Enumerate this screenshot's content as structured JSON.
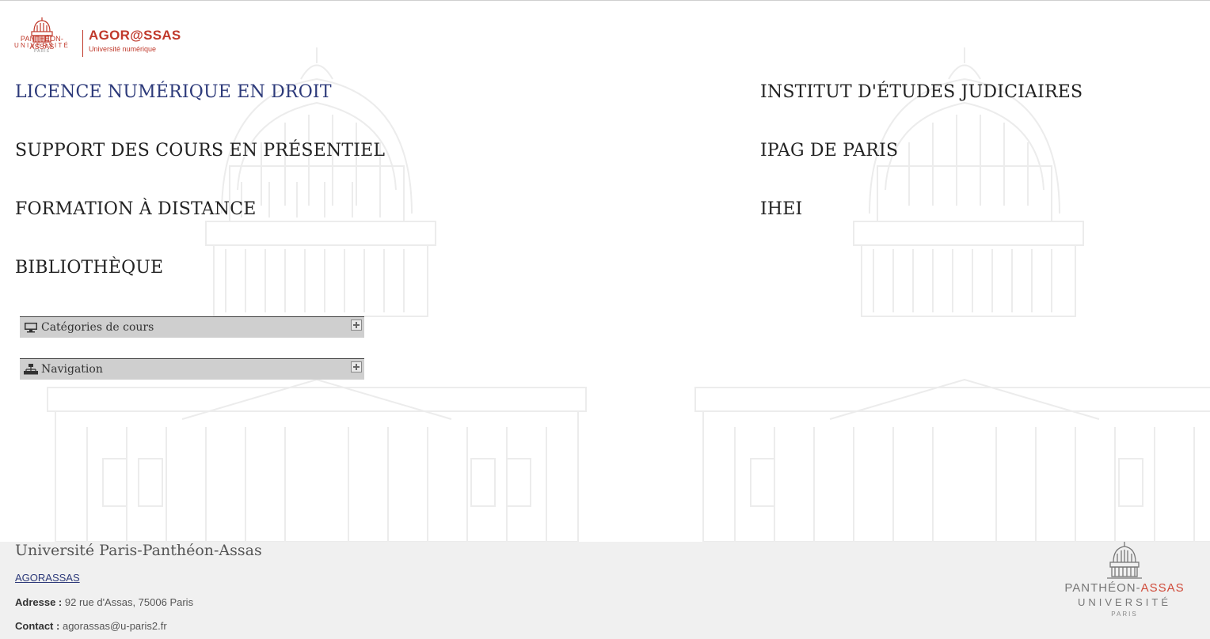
{
  "logo": {
    "university_line1": "PANTHÉON-ASSAS",
    "university_line2": "UNIVERSITÉ",
    "university_line3": "PARIS",
    "name": "AGOR@SSAS",
    "subtitle": "Université numérique"
  },
  "main_links": {
    "left": [
      "LICENCE NUMÉRIQUE EN DROIT",
      "SUPPORT DES COURS EN PRÉSENTIEL",
      "FORMATION À DISTANCE",
      "BIBLIOTHÈQUE"
    ],
    "right": [
      "INSTITUT D'ÉTUDES JUDICIAIRES",
      "IPAG DE PARIS",
      "IHEI"
    ]
  },
  "blocks": [
    {
      "title": "Catégories de cours",
      "icon": "desktop-icon"
    },
    {
      "title": "Navigation",
      "icon": "sitemap-icon"
    }
  ],
  "footer": {
    "title": "Université Paris-Panthéon-Assas",
    "link": "AGORASSAS",
    "address_label": "Adresse :",
    "address_value": "92 rue d'Assas, 75006 Paris",
    "contact_label": "Contact :",
    "contact_value": "agorassas@u-paris2.fr",
    "logo_line1a": "PANTHÉON-",
    "logo_line1b": "ASSAS",
    "logo_line2": "UNIVERSITÉ",
    "logo_line3": "PARIS"
  },
  "colors": {
    "brand_red": "#c0392b",
    "link_blue": "#2d3a7a",
    "block_bg": "#cfcfcf",
    "footer_bg": "#f0f0f0"
  }
}
